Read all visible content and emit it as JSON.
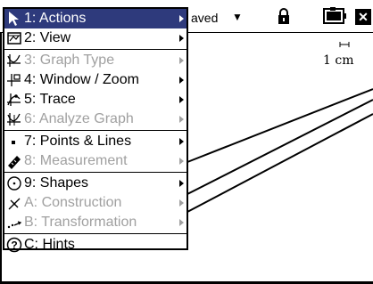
{
  "header": {
    "doc_title": "aved",
    "dropdown_icon": "caret-down-icon",
    "lock_icon": "lock-icon",
    "battery_icon": "battery-icon",
    "close_label": "✕"
  },
  "graph": {
    "scale_label": "1 cm"
  },
  "menu": {
    "items": [
      {
        "label": "1: Actions",
        "icon": "cursor-arrow-icon",
        "enabled": true,
        "selected": true
      },
      {
        "label": "2: View",
        "icon": "view-icon",
        "enabled": true,
        "selected": false
      },
      {
        "label": "3: Graph Type",
        "icon": "graph-type-icon",
        "enabled": false,
        "selected": false
      },
      {
        "label": "4: Window / Zoom",
        "icon": "window-zoom-icon",
        "enabled": true,
        "selected": false
      },
      {
        "label": "5: Trace",
        "icon": "trace-icon",
        "enabled": true,
        "selected": false
      },
      {
        "label": "6: Analyze Graph",
        "icon": "analyze-graph-icon",
        "enabled": false,
        "selected": false
      },
      {
        "label": "7: Points & Lines",
        "icon": "point-icon",
        "enabled": true,
        "selected": false
      },
      {
        "label": "8: Measurement",
        "icon": "ruler-icon",
        "enabled": false,
        "selected": false
      },
      {
        "label": "9: Shapes",
        "icon": "circle-shape-icon",
        "enabled": true,
        "selected": false
      },
      {
        "label": "A: Construction",
        "icon": "construction-icon",
        "enabled": false,
        "selected": false
      },
      {
        "label": "B: Transformation",
        "icon": "transformation-icon",
        "enabled": false,
        "selected": false
      },
      {
        "label": "C: Hints",
        "icon": "help-icon",
        "enabled": true,
        "selected": false
      }
    ]
  }
}
